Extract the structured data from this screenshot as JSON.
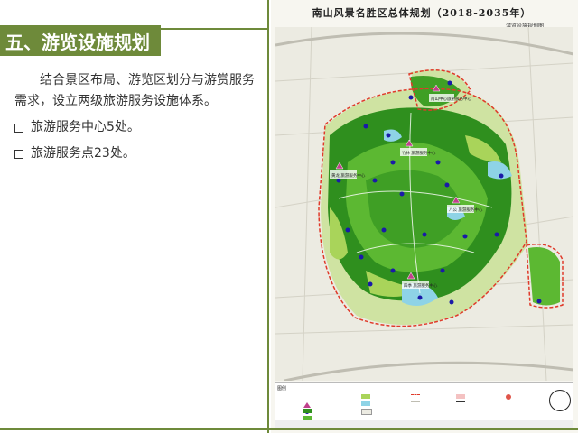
{
  "slide": {
    "title": "五、游览设施规划",
    "paragraph": "结合景区布局、游览区划分与游赏服务需求，设立两级旅游服务设施体系。",
    "bullets": [
      "旅游服务中心5处。",
      "旅游服务点23处。"
    ]
  },
  "map": {
    "title": "南山风景名胜区总体规划（2018-2035年）",
    "subtitle": "游览设施规划图",
    "legend_title": "图例",
    "labels": [
      "南山中心旅游服务中心",
      "竹林 旅游服务中心",
      "黄龙 旅游服务中心",
      "八公 旅游服务中心",
      "四季 旅游服务中心"
    ],
    "colors": {
      "accent": "#6e8a3a",
      "forest_dark": "#2f8f1e",
      "forest_mid": "#5cb832",
      "forest_light": "#a9d45a",
      "water": "#8ed3e6",
      "boundary": "#e03a2a",
      "service_point": "#1a1aa8",
      "service_center": "#c0408c"
    }
  }
}
